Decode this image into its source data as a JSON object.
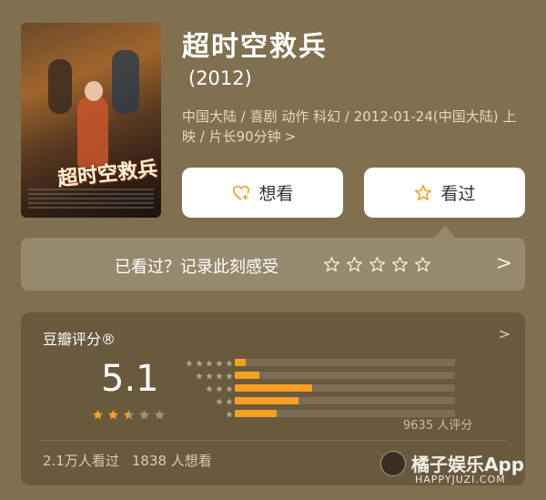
{
  "movie": {
    "title": "超时空救兵",
    "year": "(2012)",
    "meta": "中国大陆 / 喜剧 动作 科幻 / 2012-01-24(中国大陆) 上映 / 片长90分钟",
    "meta_chevron": ">",
    "poster_title": "超时空救兵"
  },
  "actions": {
    "want_label": "想看",
    "seen_label": "看过"
  },
  "record": {
    "prompt": "已看过？记录此刻感受",
    "chevron": ">"
  },
  "rating": {
    "label": "豆瓣评分®",
    "chevron": ">",
    "score": "5.1",
    "stars": 2.5,
    "distribution": [
      {
        "stars": 5,
        "fraction": 0.05
      },
      {
        "stars": 4,
        "fraction": 0.11
      },
      {
        "stars": 3,
        "fraction": 0.35
      },
      {
        "stars": 2,
        "fraction": 0.29
      },
      {
        "stars": 1,
        "fraction": 0.19
      }
    ],
    "count_text": "9635 人评分",
    "watched_text": "2.1万人看过",
    "wanted_text": "1838 人想看"
  },
  "watermark": {
    "name": "橘子娱乐App",
    "url": "HAPPYJUZI.COM"
  },
  "colors": {
    "background": "#80704f",
    "accent": "#f7a023"
  }
}
